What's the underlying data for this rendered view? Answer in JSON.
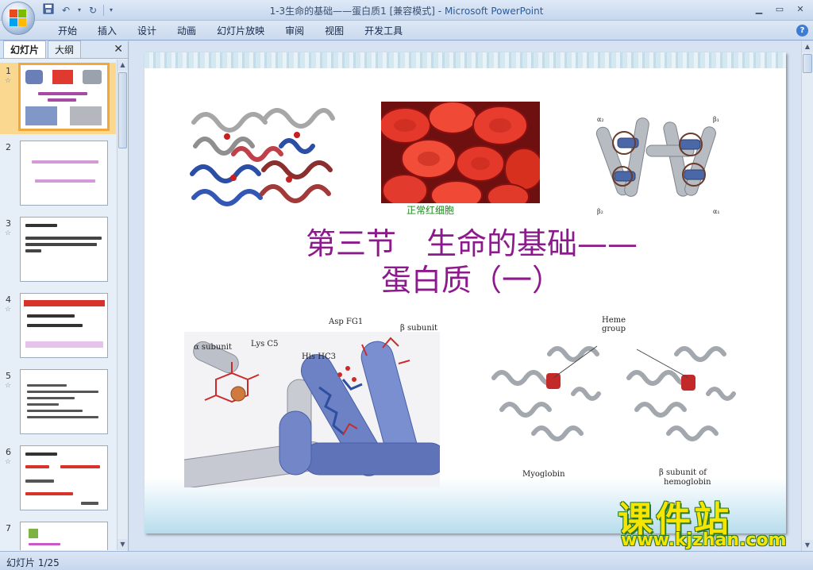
{
  "window": {
    "title_doc": "1-3生命的基础——蛋白质1 [兼容模式] - ",
    "title_app": "Microsoft PowerPoint"
  },
  "ribbon": {
    "tabs": [
      "开始",
      "插入",
      "设计",
      "动画",
      "幻灯片放映",
      "审阅",
      "视图",
      "开发工具"
    ]
  },
  "left_pane": {
    "tabs": [
      "幻灯片",
      "大纲"
    ],
    "close_glyph": "✕",
    "thumbnails": [
      {
        "number": "1",
        "selected": true
      },
      {
        "number": "2",
        "selected": false
      },
      {
        "number": "3",
        "selected": false
      },
      {
        "number": "4",
        "selected": false
      },
      {
        "number": "5",
        "selected": false
      },
      {
        "number": "6",
        "selected": false
      },
      {
        "number": "7",
        "selected": false
      }
    ]
  },
  "slide": {
    "title_line1": "第三节　生命的基础——",
    "title_line2": "蛋白质（一）",
    "rbc_caption": "正常红细胞",
    "labels": {
      "alpha_subunit": "α subunit",
      "lys_c5": "Lys C5",
      "his_hc3": "His HC3",
      "asp_fg1": "Asp FG1",
      "beta_subunit": "β subunit",
      "heme_group_1": "Heme",
      "heme_group_2": "group",
      "myoglobin": "Myoglobin",
      "beta_sub_of_1": "β subunit of",
      "beta_sub_of_2": "hemoglobin",
      "a1": "α₁",
      "a2": "α₂",
      "b1": "β₁",
      "b2": "β₂"
    }
  },
  "status": {
    "slide_counter": "幻灯片 1/25"
  },
  "watermark": {
    "brand": "课件站",
    "url": "www.kjzhan.com"
  }
}
